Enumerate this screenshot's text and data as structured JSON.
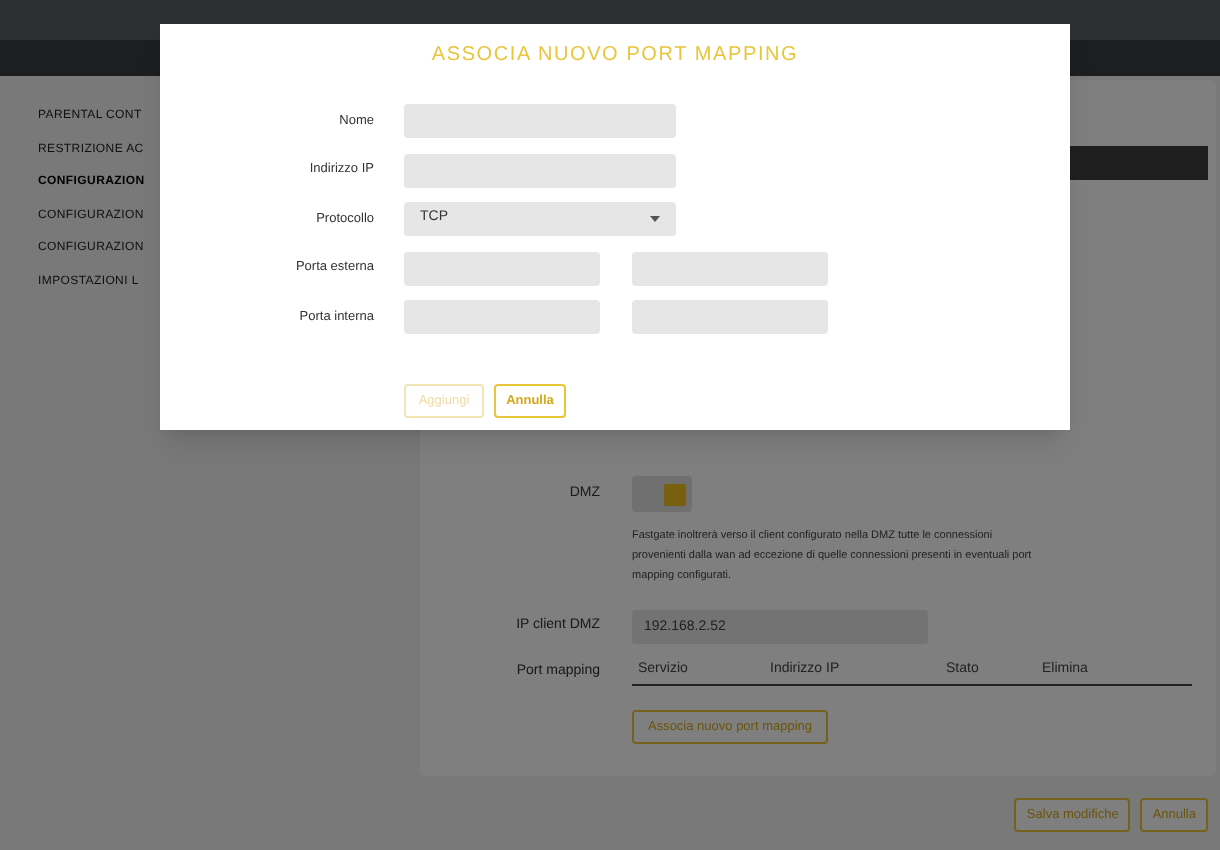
{
  "sidebar": {
    "items": [
      {
        "label": "PARENTAL CONT",
        "selected": false
      },
      {
        "label": "RESTRIZIONE AC",
        "selected": false
      },
      {
        "label": "CONFIGURAZION",
        "selected": true
      },
      {
        "label": "CONFIGURAZION",
        "selected": false
      },
      {
        "label": "CONFIGURAZION",
        "selected": false
      },
      {
        "label": "IMPOSTAZIONI L",
        "selected": false
      }
    ]
  },
  "main": {
    "dmz": {
      "label": "DMZ",
      "on": true,
      "description": "Fastgate inoltrerà verso il client configurato nella DMZ tutte le connessioni provenienti dalla wan ad eccezione di quelle connessioni presenti in eventuali port mapping configurati."
    },
    "ip_client_dmz": {
      "label": "IP client DMZ",
      "value": "192.168.2.52"
    },
    "port_mapping": {
      "label": "Port mapping",
      "columns": [
        "Servizio",
        "Indirizzo IP",
        "Stato",
        "Elimina"
      ],
      "add_button": "Associa nuovo port mapping"
    }
  },
  "footer": {
    "buttons": [
      "Salva modifiche",
      "Annulla"
    ]
  },
  "modal": {
    "title": "ASSOCIA NUOVO PORT MAPPING",
    "fields": [
      {
        "label": "Nome",
        "kind": "text"
      },
      {
        "label": "Indirizzo IP",
        "kind": "text"
      },
      {
        "label": "Protocollo",
        "kind": "select",
        "value": "TCP"
      },
      {
        "label": "Porta esterna",
        "kind": "range"
      },
      {
        "label": "Porta interna",
        "kind": "range"
      }
    ],
    "buttons": [
      {
        "label": "Aggiungi",
        "disabled": true
      },
      {
        "label": "Annulla",
        "disabled": false
      }
    ]
  }
}
